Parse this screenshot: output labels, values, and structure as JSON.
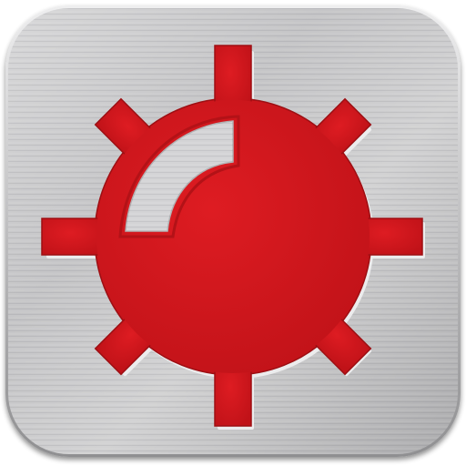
{
  "icon": {
    "name": "minesweeper-app-icon",
    "glyph": "mine-icon",
    "colors": {
      "background": "#ffffff",
      "metal_light": "#d9d9da",
      "metal_mid": "#b4b4b6",
      "metal_dark": "#8e8e90",
      "mine_red": "#d4161c",
      "mine_red_dark": "#a80f14",
      "mine_highlight": "#e2e2e4"
    }
  }
}
